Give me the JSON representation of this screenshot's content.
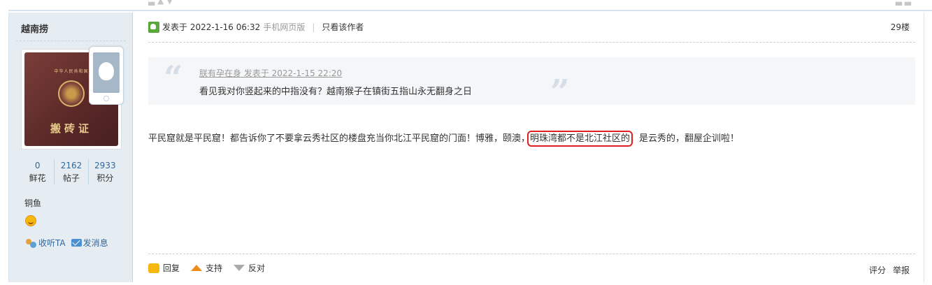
{
  "post": {
    "author": "越南捞",
    "stats": [
      {
        "num": "0",
        "label": "鲜花"
      },
      {
        "num": "2162",
        "label": "帖子"
      },
      {
        "num": "2933",
        "label": "积分"
      }
    ],
    "rank": "铜鱼",
    "side_actions": {
      "follow": "收听TA",
      "message": "发消息"
    },
    "meta": {
      "posted": "发表于 2022-1-16 06:32",
      "device": "手机网页版",
      "only_author": "只看该作者",
      "floor": "29楼"
    },
    "quote": {
      "header": "朕有孕在身 发表于 2022-1-15 22:20",
      "body": "看见我对你竖起来的中指没有？越南猴子在镇街五指山永无翻身之日"
    },
    "content": {
      "before": "平民窟就是平民窟！都告诉你了不要拿云秀社区的楼盘充当你北江平民窟的门面！博雅，颐澳，",
      "highlight": "明珠湾都不是北江社区的",
      "after": "，是云秀的，翻屋企训啦！"
    },
    "actions": {
      "reply": "回复",
      "support": "支持",
      "oppose": "反对"
    },
    "right_actions": {
      "rate": "评分",
      "report": "举报"
    },
    "avatar_text": "搬砖证",
    "avatar_header": "中华人民共和国"
  },
  "colors": {
    "link": "#336699",
    "sidebar": "#e5edf2",
    "highlight_border": "#e02020"
  }
}
